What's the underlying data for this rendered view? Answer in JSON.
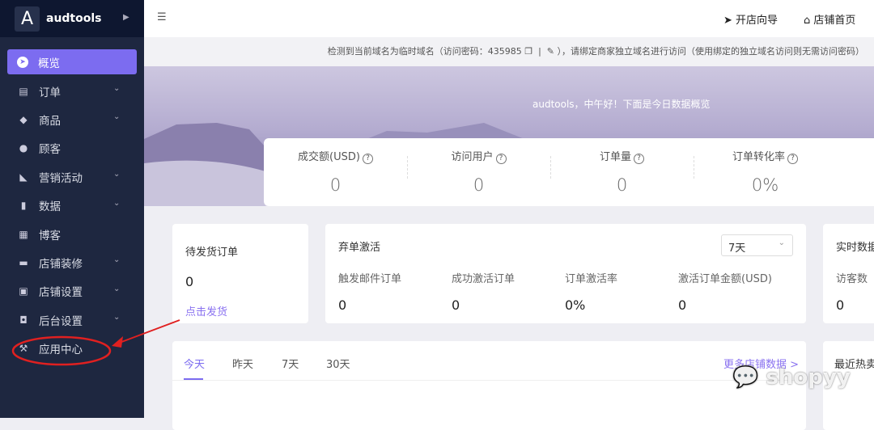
{
  "brand": {
    "logo_letter": "A",
    "name": "audtools"
  },
  "sidebar": {
    "items": [
      {
        "label": "概览",
        "icon": "compass-icon",
        "active": true
      },
      {
        "label": "订单",
        "icon": "clipboard-icon",
        "chevron": true
      },
      {
        "label": "商品",
        "icon": "box-icon",
        "chevron": true
      },
      {
        "label": "顾客",
        "icon": "user-icon"
      },
      {
        "label": "营销活动",
        "icon": "tag-icon",
        "chevron": true
      },
      {
        "label": "数据",
        "icon": "bar-chart-icon",
        "chevron": true
      },
      {
        "label": "博客",
        "icon": "document-icon"
      },
      {
        "label": "店铺装修",
        "icon": "paint-roller-icon",
        "chevron": true
      },
      {
        "label": "店铺设置",
        "icon": "store-icon",
        "chevron": true
      },
      {
        "label": "后台设置",
        "icon": "monitor-icon",
        "chevron": true
      },
      {
        "label": "应用中心",
        "icon": "wrench-icon"
      }
    ]
  },
  "topbar": {
    "guide": "开店向导",
    "home": "店铺首页"
  },
  "notice": {
    "part1": "检测到当前域名为临时域名（访问密码：435985",
    "part2": "），请绑定商家独立域名进行访问（使用绑定的独立域名访问则无需访问密码）"
  },
  "banner": {
    "greeting": "audtools，中午好！下面是今日数据概览"
  },
  "stats": [
    {
      "label": "成交额(USD)",
      "value": "0"
    },
    {
      "label": "访问用户",
      "value": "0"
    },
    {
      "label": "订单量",
      "value": "0"
    },
    {
      "label": "订单转化率",
      "value": "0%"
    }
  ],
  "pending": {
    "title": "待发货订单",
    "value": "0",
    "link": "点击发货"
  },
  "abandon": {
    "title": "弃单激活",
    "range": "7天",
    "metrics": [
      {
        "label": "触发邮件订单",
        "value": "0"
      },
      {
        "label": "成功激活订单",
        "value": "0"
      },
      {
        "label": "订单激活率",
        "value": "0%"
      },
      {
        "label": "激活订单金额(USD)",
        "value": "0"
      }
    ]
  },
  "realtime": {
    "title": "实时数据",
    "label": "访客数",
    "value": "0"
  },
  "tabs": {
    "items": [
      "今天",
      "昨天",
      "7天",
      "30天"
    ],
    "more": "更多店铺数据 >"
  },
  "hot": {
    "title": "最近热卖"
  },
  "watermark": "shopyy",
  "colors": {
    "accent": "#7c6cf0",
    "sidebar": "#1e2740",
    "annotation": "#e02020"
  }
}
